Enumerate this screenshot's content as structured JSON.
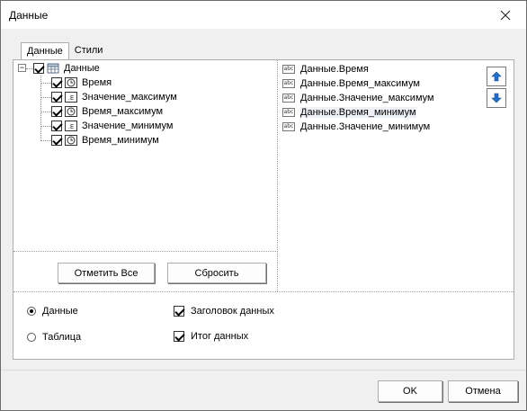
{
  "window": {
    "title": "Данные"
  },
  "tabs": [
    {
      "label": "Данные"
    },
    {
      "label": "Стили"
    }
  ],
  "tree": {
    "root": {
      "label": "Данные"
    },
    "children": [
      {
        "label": "Время",
        "icon": "clock-icon"
      },
      {
        "label": "Значение_максимум",
        "icon": "numeric-field-icon"
      },
      {
        "label": "Время_максимум",
        "icon": "clock-icon"
      },
      {
        "label": "Значение_минимум",
        "icon": "numeric-field-icon"
      },
      {
        "label": "Время_минимум",
        "icon": "clock-icon"
      }
    ]
  },
  "selected_fields": [
    {
      "label": "Данные.Время"
    },
    {
      "label": "Данные.Время_максимум"
    },
    {
      "label": "Данные.Значение_максимум"
    },
    {
      "label": "Данные.Время_минимум"
    },
    {
      "label": "Данные.Значение_минимум"
    }
  ],
  "field_icon_text": "abc",
  "buttons": {
    "check_all": "Отметить Все",
    "reset": "Сбросить",
    "ok": "OK",
    "cancel": "Отмена"
  },
  "view_options": {
    "data_label": "Данные",
    "table_label": "Таблица",
    "selected": "Данные"
  },
  "checkboxes": {
    "header_label": "Заголовок данных",
    "header_checked": true,
    "total_label": "Итог данных",
    "total_checked": true
  },
  "colors": {
    "arrow_blue": "#1f6fd1",
    "selection": "#eef2f8"
  }
}
